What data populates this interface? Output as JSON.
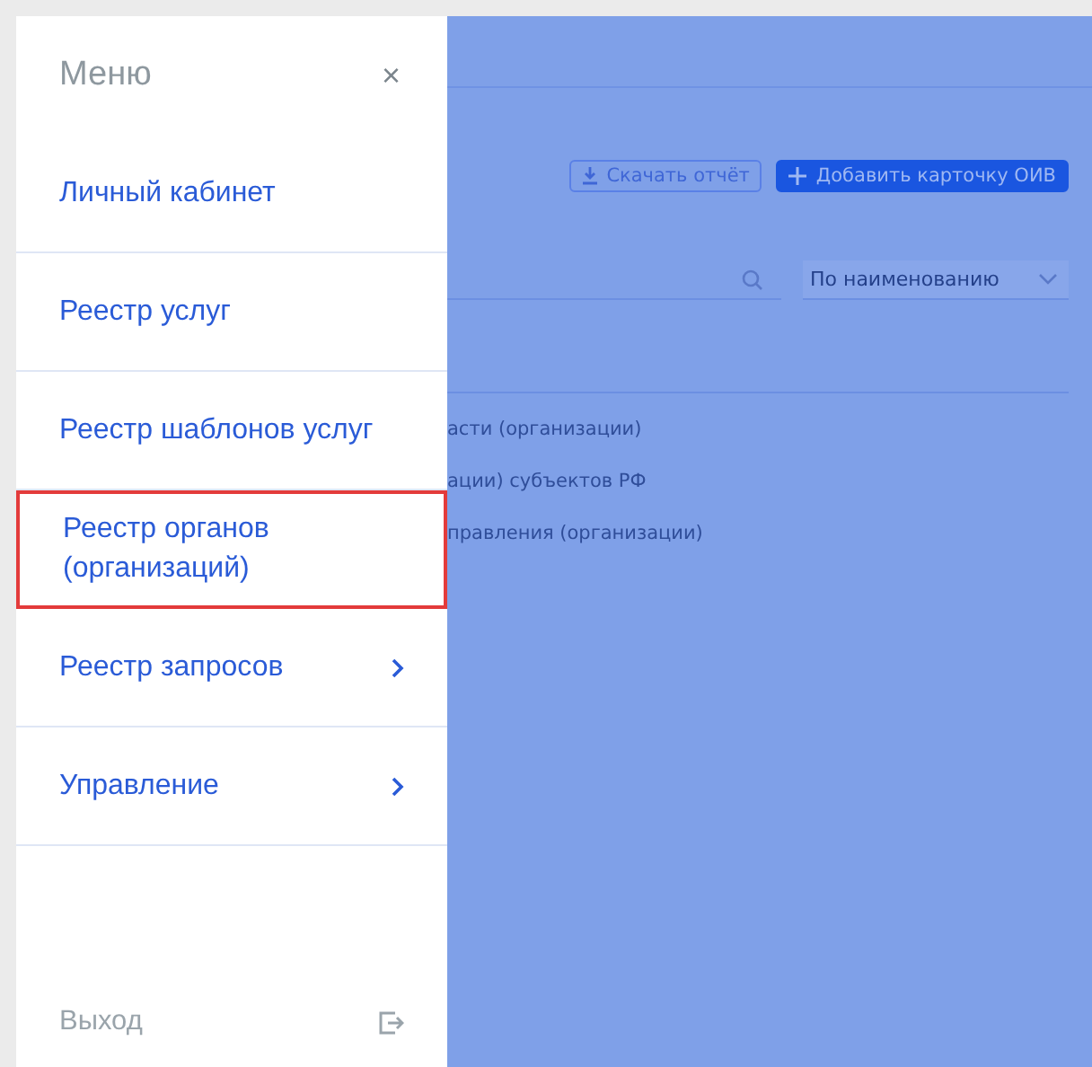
{
  "menu": {
    "title": "Меню",
    "close": "×",
    "items": [
      {
        "label": "Личный кабинет",
        "has_submenu": false,
        "highlighted": false
      },
      {
        "label": "Реестр услуг",
        "has_submenu": false,
        "highlighted": false
      },
      {
        "label": "Реестр шаблонов услуг",
        "has_submenu": false,
        "highlighted": false
      },
      {
        "label": "Реестр органов (организаций)",
        "has_submenu": false,
        "highlighted": true
      },
      {
        "label": "Реестр запросов",
        "has_submenu": true,
        "highlighted": false
      },
      {
        "label": "Управление",
        "has_submenu": true,
        "highlighted": false
      }
    ],
    "logout": "Выход"
  },
  "page": {
    "buttons": [
      {
        "kind": "outline",
        "label": "Скачать отчёт"
      },
      {
        "kind": "primary",
        "label": "Добавить карточку ОИВ"
      }
    ],
    "sort": {
      "value": "По наименованию"
    },
    "rows": [
      "асти (организации)",
      "ации) субъектов РФ",
      "правления (организации)"
    ]
  }
}
